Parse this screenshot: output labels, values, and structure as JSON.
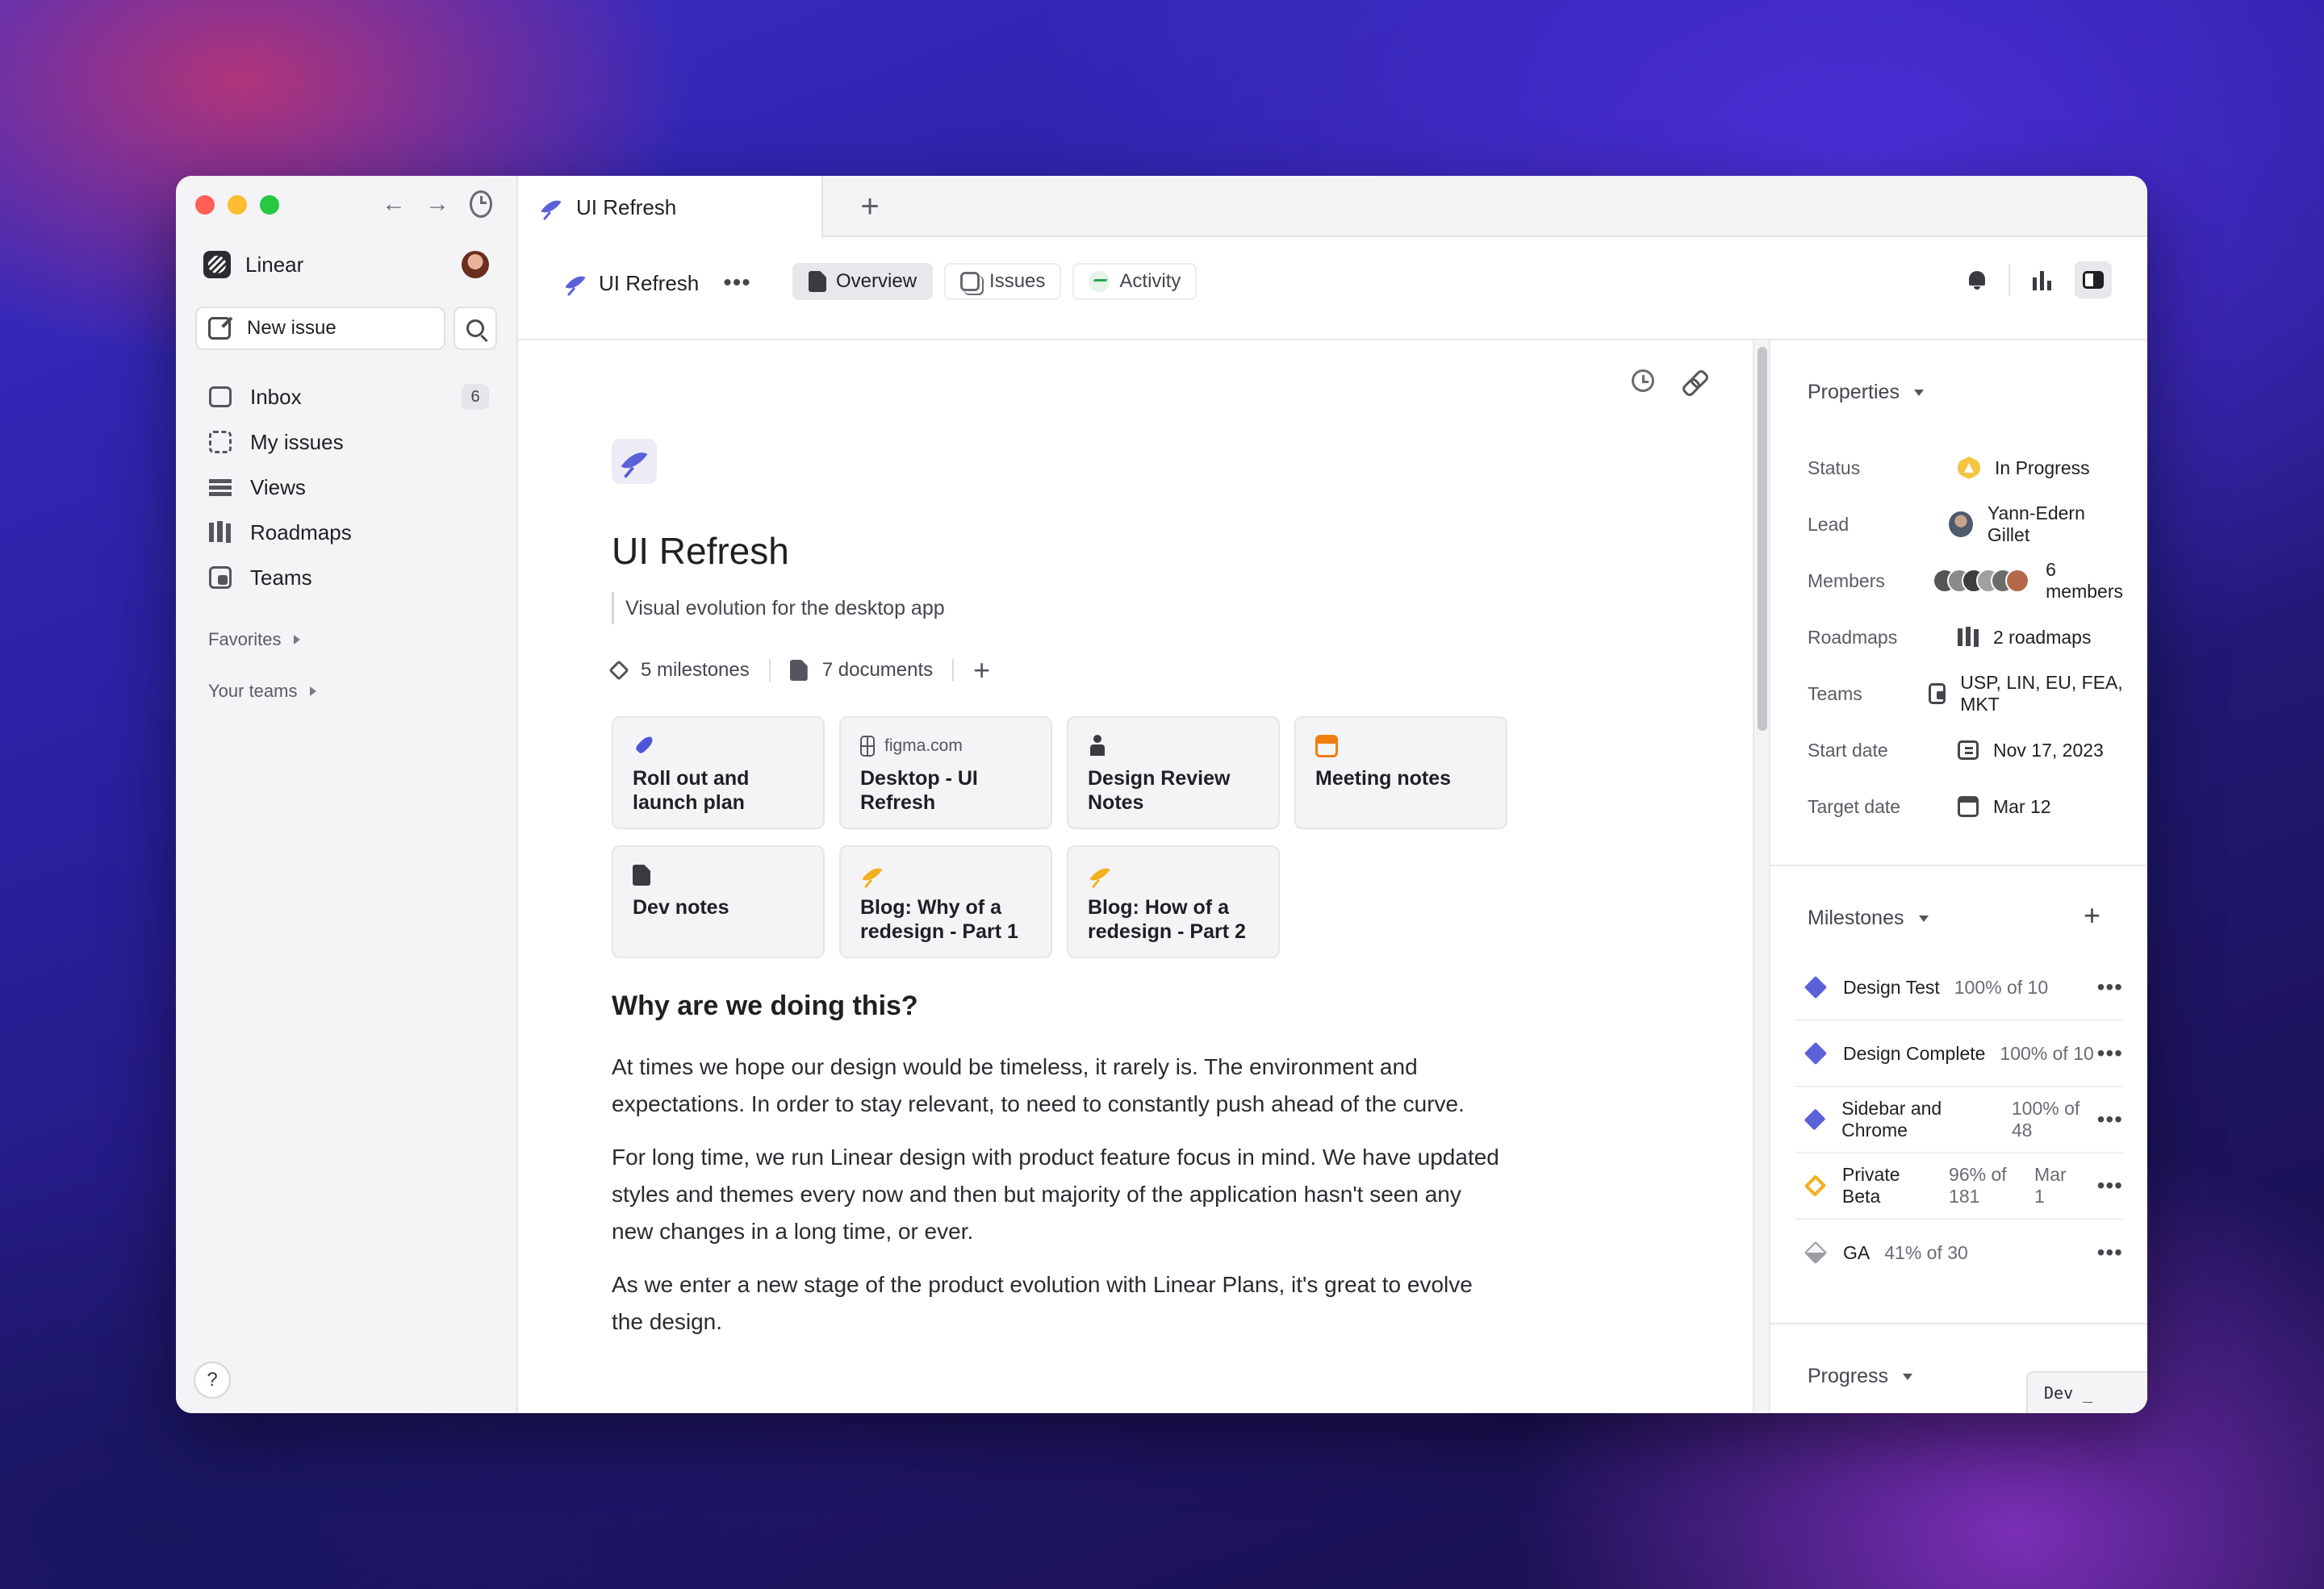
{
  "sidebar": {
    "workspace": "Linear",
    "new_issue": "New issue",
    "items": [
      {
        "label": "Inbox",
        "icon": "inbox-icon",
        "badge": "6"
      },
      {
        "label": "My issues",
        "icon": "my-issues-icon"
      },
      {
        "label": "Views",
        "icon": "views-icon"
      },
      {
        "label": "Roadmaps",
        "icon": "roadmaps-icon"
      },
      {
        "label": "Teams",
        "icon": "teams-icon"
      }
    ],
    "favorites": "Favorites",
    "your_teams": "Your teams",
    "help": "?"
  },
  "tabbar": {
    "active_tab": "UI Refresh",
    "add": "+"
  },
  "header": {
    "project": "UI Refresh",
    "more": "•••",
    "tabs": {
      "overview": "Overview",
      "issues": "Issues",
      "activity": "Activity"
    }
  },
  "doc": {
    "title": "UI Refresh",
    "subtitle": "Visual evolution for the desktop app",
    "milestones_count": "5 milestones",
    "documents_count": "7 documents",
    "add": "+",
    "cards": [
      {
        "top": "",
        "title": "Roll out and launch plan",
        "icon": "rocket-icon"
      },
      {
        "top": "figma.com",
        "title": "Desktop - UI Refresh",
        "icon": "figma-icon"
      },
      {
        "top": "",
        "title": "Design Review Notes",
        "icon": "person-icon"
      },
      {
        "top": "",
        "title": "Meeting notes",
        "icon": "calendar-icon"
      },
      {
        "top": "",
        "title": "Dev notes",
        "icon": "document-icon"
      },
      {
        "top": "",
        "title": "Blog: Why of a redesign - Part 1",
        "icon": "feather-icon"
      },
      {
        "top": "",
        "title": "Blog: How of a redesign - Part 2",
        "icon": "feather-icon"
      }
    ],
    "heading": "Why are we doing this?",
    "paragraphs": [
      "At times we hope our design would be timeless, it rarely is. The environment and expectations. In order to stay relevant, to need to constantly push ahead of the curve.",
      "For long time, we run Linear design with product feature focus in mind. We have updated styles and themes every now and then but majority of the application hasn't seen any new changes in a long time, or ever.",
      "As we enter a new stage of the product evolution with Linear Plans, it's great to evolve the design."
    ]
  },
  "properties": {
    "heading": "Properties",
    "rows": {
      "status": {
        "label": "Status",
        "value": "In Progress"
      },
      "lead": {
        "label": "Lead",
        "value": "Yann-Edern Gillet"
      },
      "members": {
        "label": "Members",
        "value": "6 members"
      },
      "roadmaps": {
        "label": "Roadmaps",
        "value": "2 roadmaps"
      },
      "teams": {
        "label": "Teams",
        "value": "USP, LIN, EU, FEA, MKT"
      },
      "start": {
        "label": "Start date",
        "value": "Nov 17, 2023"
      },
      "target": {
        "label": "Target date",
        "value": "Mar 12"
      }
    }
  },
  "milestones": {
    "heading": "Milestones",
    "add": "+",
    "items": [
      {
        "name": "Design Test",
        "progress": "100% of 10",
        "date": "",
        "kind": "complete"
      },
      {
        "name": "Design Complete",
        "progress": "100% of 10",
        "date": "",
        "kind": "complete"
      },
      {
        "name": "Sidebar and Chrome",
        "progress": "100% of 48",
        "date": "",
        "kind": "complete"
      },
      {
        "name": "Private Beta",
        "progress": "96% of 181",
        "date": "Mar 1",
        "kind": "beta"
      },
      {
        "name": "GA",
        "progress": "41% of 30",
        "date": "",
        "kind": "ga"
      }
    ],
    "more": "•••"
  },
  "progress": {
    "heading": "Progress"
  },
  "dev_tag": "Dev _",
  "colors": {
    "accent": "#5b61d9",
    "status_in_progress": "#f5c542",
    "beta": "#f2b01e",
    "calendar_orange": "#f07d10",
    "activity_green": "#2aa44f"
  }
}
